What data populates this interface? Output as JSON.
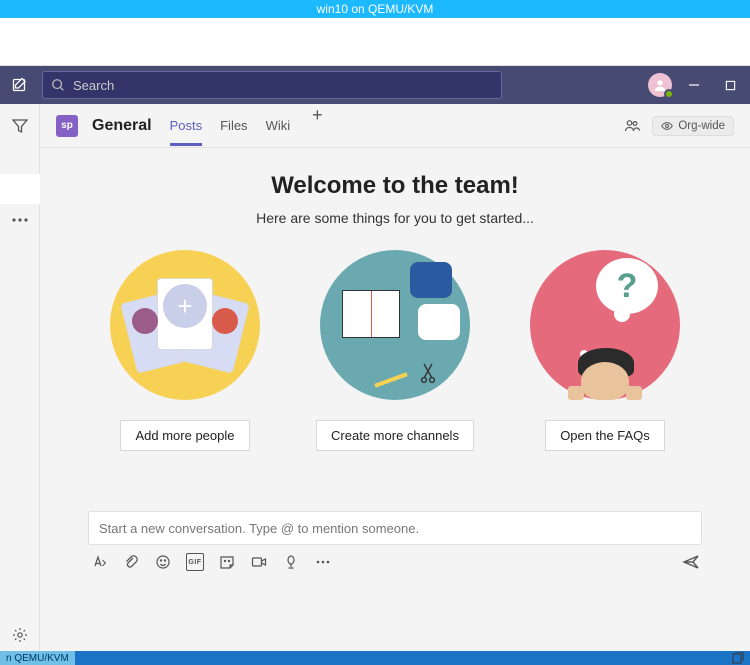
{
  "vm_banner": "win10 on QEMU/KVM",
  "search": {
    "placeholder": "Search"
  },
  "channel": {
    "tile_initials": "sp",
    "name": "General",
    "tabs": [
      "Posts",
      "Files",
      "Wiki"
    ],
    "active_tab": 0,
    "orgwide_label": "Org-wide"
  },
  "welcome": {
    "title": "Welcome to the team!",
    "subtitle": "Here are some things for you to get started..."
  },
  "cards": {
    "add_people": "Add more people",
    "create_channels": "Create more channels",
    "open_faqs": "Open the FAQs",
    "faq_mark": "?"
  },
  "compose": {
    "placeholder": "Start a new conversation. Type @ to mention someone.",
    "gif_label": "GIF"
  },
  "taskbar": {
    "fragment": "n QEMU/KVM"
  }
}
